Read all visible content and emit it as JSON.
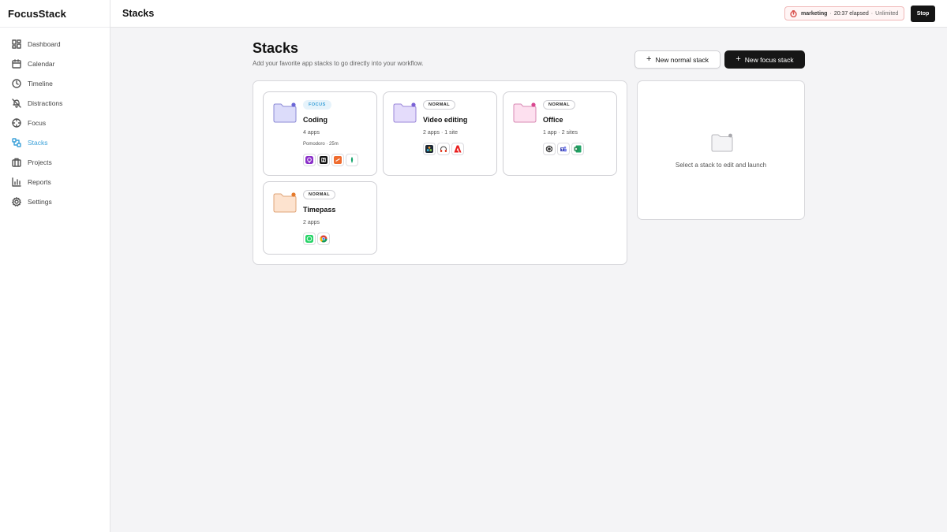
{
  "app": {
    "name": "FocusStack"
  },
  "sidebar": {
    "items": [
      {
        "label": "Dashboard",
        "icon": "dashboard-icon",
        "active": false
      },
      {
        "label": "Calendar",
        "icon": "calendar-icon",
        "active": false
      },
      {
        "label": "Timeline",
        "icon": "clock-icon",
        "active": false
      },
      {
        "label": "Distractions",
        "icon": "bell-off-icon",
        "active": false
      },
      {
        "label": "Focus",
        "icon": "focus-icon",
        "active": false
      },
      {
        "label": "Stacks",
        "icon": "stacks-icon",
        "active": true
      },
      {
        "label": "Projects",
        "icon": "projects-icon",
        "active": false
      },
      {
        "label": "Reports",
        "icon": "chart-icon",
        "active": false
      },
      {
        "label": "Settings",
        "icon": "gear-icon",
        "active": false
      }
    ]
  },
  "topbar": {
    "title": "Stacks",
    "session": {
      "name": "marketing",
      "elapsed": "20:37 elapsed",
      "limit": "Unlimited",
      "sep": "·"
    },
    "stop_label": "Stop"
  },
  "main": {
    "title": "Stacks",
    "subtitle": "Add your favorite app stacks to go directly into your workflow.",
    "new_normal_label": "New normal stack",
    "new_focus_label": "New focus stack"
  },
  "stacks": [
    {
      "name": "Coding",
      "type": "FOCUS",
      "meta": "4 apps",
      "meta2": "Pomodoro · 25m",
      "folder_color": "#dcdcfa",
      "folder_stroke": "#8b8ad6",
      "dot_color": "#6b66d6",
      "icons": [
        "podcast-app-icon",
        "notion-icon",
        "sublime-icon",
        "sketch-icon"
      ]
    },
    {
      "name": "Video editing",
      "type": "NORMAL",
      "meta": "2 apps · 1 site",
      "meta2": "",
      "folder_color": "#e4dcfb",
      "folder_stroke": "#9a86d8",
      "dot_color": "#7a62d6",
      "icons": [
        "davinci-icon",
        "headphones-icon",
        "adobe-icon"
      ]
    },
    {
      "name": "Office",
      "type": "NORMAL",
      "meta": "1 app · 2 sites",
      "meta2": "",
      "folder_color": "#fde0ef",
      "folder_stroke": "#d889b3",
      "dot_color": "#d9468f",
      "icons": [
        "chatgpt-icon",
        "teams-icon",
        "excel-icon"
      ]
    },
    {
      "name": "Timepass",
      "type": "NORMAL",
      "meta": "2 apps",
      "meta2": "",
      "folder_color": "#fde3cf",
      "folder_stroke": "#e0a478",
      "dot_color": "#e57a2b",
      "icons": [
        "whatsapp-icon",
        "chrome-icon"
      ]
    }
  ],
  "detail": {
    "empty_text": "Select a stack to edit and launch"
  },
  "colors": {
    "accent": "#3aa0d8",
    "dark": "#161616",
    "stop_border": "#f0b8b8"
  }
}
